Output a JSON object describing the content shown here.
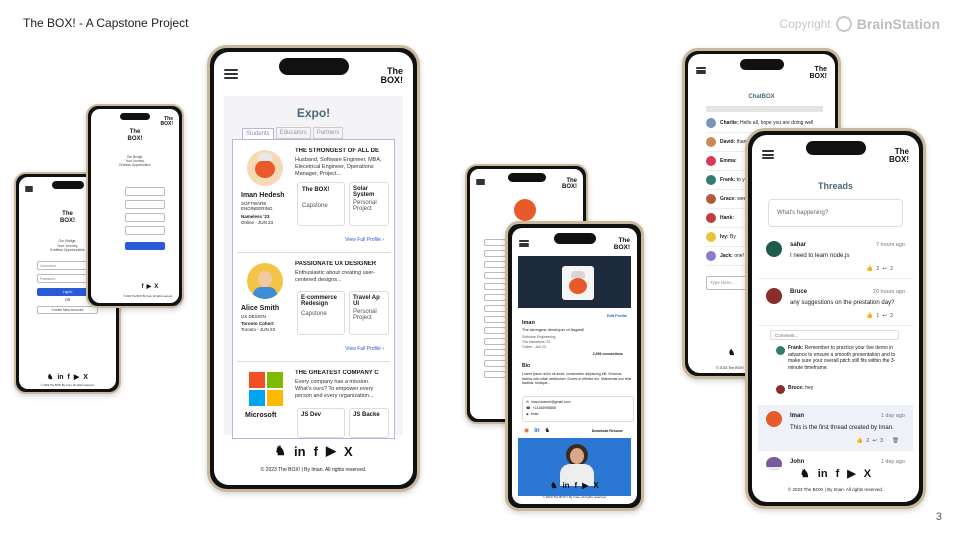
{
  "slide": {
    "title": "The BOX! - A Capstone Project",
    "copyright": "Copyright",
    "brand": "BrainStation",
    "page": "3"
  },
  "brand": {
    "line1": "The",
    "line2": "BOX!"
  },
  "login": {
    "tag1": "Our Bridge,",
    "tag2": "Your Journey,",
    "tag3": "Endless Opportunities",
    "username": "Username",
    "password": "Password",
    "login": "Log In",
    "or": "OR",
    "create": "Create New Account",
    "footer": "© 2023 The BOX! By Iman. All rights reserved."
  },
  "expo": {
    "title": "Expo!",
    "tabs": [
      "Students",
      "Educators",
      "Partners"
    ],
    "cards": [
      {
        "name": "Iman Hedesh",
        "role": "SOFTWARE ENGINEERING",
        "cohort": "Nameless '23",
        "meta": "Online - JUN 23",
        "headline": "THE STRONGEST OF ALL DE",
        "bio": "Husband, Software Engineer, MBA, Elecetrical Engineer, Operations Manager, Project...",
        "proj1": "The BOX!",
        "proj1s": "Capstone",
        "proj2": "Solar System",
        "proj2s": "Personal Project",
        "link": "View Full Profile"
      },
      {
        "name": "Alice Smith",
        "role": "UX DESIGN",
        "cohort": "Toronto Cohort",
        "meta": "Toronto - JUN 23",
        "headline": "PASSIONATE UX DESIGNER",
        "bio": "Enthusiastic about creating user-centered designs...",
        "proj1": "E-commerce Redesign",
        "proj1s": "Capstone",
        "proj2": "Travel Ap UI",
        "proj2s": "Personal Project",
        "link": "View Full Profile"
      },
      {
        "name": "Microsoft",
        "headline": "THE GREATEST COMPANY C",
        "bio": "Every company has a mission. What's ours? To empower every person and every organization...",
        "proj1": "JS Dev",
        "proj2": "JS Backe"
      }
    ],
    "footer": "© 2023 The BOX! | By Iman. All rights reserved."
  },
  "profile": {
    "edit": "Edit Profile",
    "name": "Iman",
    "headline": "The strongest developer of Asgard!",
    "school": "Software Engineering",
    "cohort": "The Nameless '23",
    "meta": "Online - Jun 23",
    "connections": "2,396 connections",
    "bio_label": "Bio",
    "bio": "Lorem ipsum dolor sit amet, consectetur adipiscing elit. Vivamus lacinia odio vitae vestibulum. Donec in efficitur leo. Maecenas non felis facilisis, tristique...",
    "email": "iman.hedesh@gmail.com",
    "phone": "+14165998858",
    "social": "Iman",
    "resume": "Download Resume",
    "footer": "© 2023 The BOX! | By Iman. All rights reserved."
  },
  "chatbox": {
    "title": "ChatBOX",
    "placeholder": "Type Here...",
    "footer": "© 2023 The BOX!",
    "items": [
      {
        "name": "Charlie:",
        "msg": "Hello all, hope you are doing well"
      },
      {
        "name": "David:",
        "msg": "thanks"
      },
      {
        "name": "Emma:",
        "msg": ""
      },
      {
        "name": "Frank:",
        "msg": "to you"
      },
      {
        "name": "Grace:",
        "msg": "weeks"
      },
      {
        "name": "Hank:",
        "msg": ""
      },
      {
        "name": "Ivy:",
        "msg": "By"
      },
      {
        "name": "Jack:",
        "msg": "one!"
      }
    ]
  },
  "threads": {
    "title": "Threads",
    "placeholder": "What's happening?",
    "posts": [
      {
        "user": "sahar",
        "time": "7 hours ago",
        "text": "I need to learn node.js",
        "likes": "2",
        "replies": "2"
      },
      {
        "user": "Bruce",
        "time": "20 hours ago",
        "text": "any suggestions on the prestation day?",
        "likes": "1",
        "replies": "2"
      },
      {
        "user": "Iman",
        "time": "1 day ago",
        "text": "This is the first thread created by Iman.",
        "likes": "2",
        "replies": "3"
      },
      {
        "user": "John",
        "time": "1 day ago",
        "text": ""
      }
    ],
    "comment_placeholder": "Comment...",
    "comments": [
      {
        "user": "Frank:",
        "text": "Remember to practice your live demo in advance to ensure a smooth presentation and to make sure your overall pitch still fits within the 3-minute timeframe."
      },
      {
        "user": "Bruce:",
        "text": "hey"
      }
    ],
    "footer": "© 2023 The BOX! | By Iman. All rights reserved."
  },
  "colors": {
    "accent": "#2a5bd7",
    "gold": "#c9b89a",
    "teal": "#4a6877"
  }
}
